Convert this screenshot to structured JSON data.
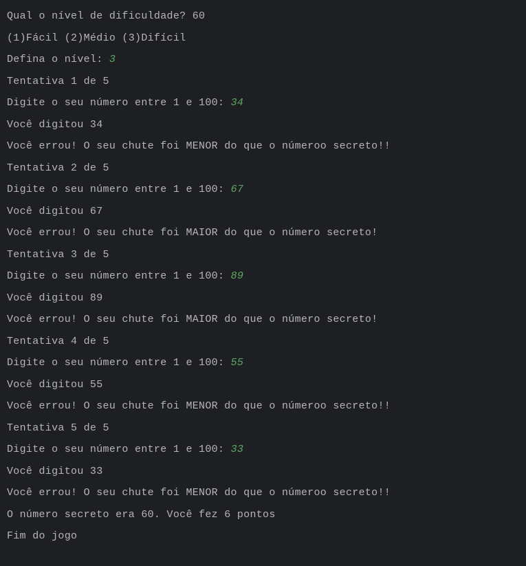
{
  "lines": [
    {
      "type": "plain",
      "text": "Qual o nível de dificuldade? 60"
    },
    {
      "type": "plain",
      "text": "(1)Fácil (2)Médio (3)Difícil"
    },
    {
      "type": "prompt",
      "prompt": "Defina o nível: ",
      "input": "3"
    },
    {
      "type": "plain",
      "text": "Tentativa 1 de 5"
    },
    {
      "type": "prompt",
      "prompt": "Digite o seu número entre 1 e 100: ",
      "input": "34"
    },
    {
      "type": "plain",
      "text": "Você digitou 34"
    },
    {
      "type": "plain",
      "text": "Você errou! O seu chute foi MENOR do que o númeroo secreto!!"
    },
    {
      "type": "plain",
      "text": "Tentativa 2 de 5"
    },
    {
      "type": "prompt",
      "prompt": "Digite o seu número entre 1 e 100: ",
      "input": "67"
    },
    {
      "type": "plain",
      "text": "Você digitou 67"
    },
    {
      "type": "plain",
      "text": "Você errou! O seu chute foi MAIOR do que o número secreto!"
    },
    {
      "type": "plain",
      "text": "Tentativa 3 de 5"
    },
    {
      "type": "prompt",
      "prompt": "Digite o seu número entre 1 e 100: ",
      "input": "89"
    },
    {
      "type": "plain",
      "text": "Você digitou 89"
    },
    {
      "type": "plain",
      "text": "Você errou! O seu chute foi MAIOR do que o número secreto!"
    },
    {
      "type": "plain",
      "text": "Tentativa 4 de 5"
    },
    {
      "type": "prompt",
      "prompt": "Digite o seu número entre 1 e 100: ",
      "input": "55"
    },
    {
      "type": "plain",
      "text": "Você digitou 55"
    },
    {
      "type": "plain",
      "text": "Você errou! O seu chute foi MENOR do que o númeroo secreto!!"
    },
    {
      "type": "plain",
      "text": "Tentativa 5 de 5"
    },
    {
      "type": "prompt",
      "prompt": "Digite o seu número entre 1 e 100: ",
      "input": "33"
    },
    {
      "type": "plain",
      "text": "Você digitou 33"
    },
    {
      "type": "plain",
      "text": "Você errou! O seu chute foi MENOR do que o númeroo secreto!!"
    },
    {
      "type": "plain",
      "text": "O número secreto era 60. Você fez 6 pontos"
    },
    {
      "type": "plain",
      "text": "Fim do jogo"
    }
  ]
}
